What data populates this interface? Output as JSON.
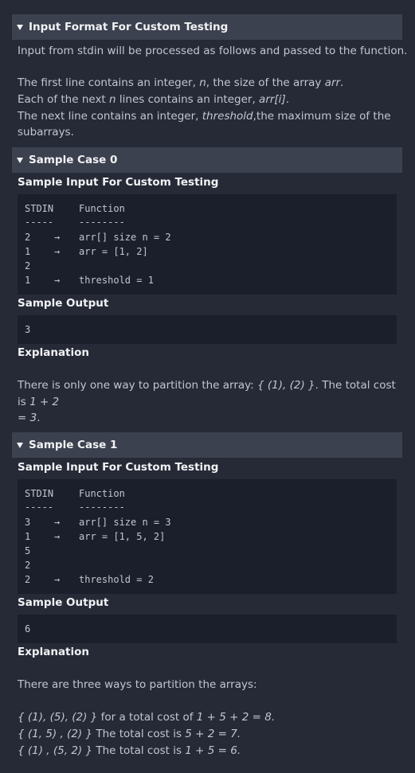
{
  "input_format": {
    "header": "Input Format For Custom Testing",
    "intro": "Input from stdin will be processed as follows and passed to the function.",
    "line1_a": "The first line contains an integer, ",
    "line1_n": "n",
    "line1_b": ", the size of the array ",
    "line1_arr": "arr",
    "line1_c": ".",
    "line2_a": "Each of the next ",
    "line2_n": "n",
    "line2_b": " lines contains an integer, ",
    "line2_arr": "arr[i]",
    "line2_c": ".",
    "line3_a": "The next line contains an integer, ",
    "line3_t": "threshold",
    "line3_b": ",the maximum size of the",
    "line3_c": "subarrays."
  },
  "case0": {
    "header": "Sample Case 0",
    "input_label": "Sample Input For Custom Testing",
    "col_stdin": "STDIN",
    "col_function": "Function",
    "sep_stdin": "-----",
    "sep_function": "--------",
    "rows": [
      {
        "stdin": "2",
        "arrow": "→",
        "fn": "arr[] size n = 2"
      },
      {
        "stdin": "1",
        "arrow": "→",
        "fn": "arr = [1, 2]"
      },
      {
        "stdin": "2",
        "arrow": "",
        "fn": ""
      },
      {
        "stdin": "1",
        "arrow": "→",
        "fn": "threshold = 1"
      }
    ],
    "output_label": "Sample Output",
    "output": "3",
    "explanation_label": "Explanation",
    "expl_a": "There is only one way to partition the array: ",
    "expl_part": "{ (1), (2) }",
    "expl_b": ". The total cost is ",
    "expl_sum": "1 + 2",
    "expl_eq": "= 3",
    "expl_end": "."
  },
  "case1": {
    "header": "Sample Case 1",
    "input_label": "Sample Input For Custom Testing",
    "col_stdin": "STDIN",
    "col_function": "Function",
    "sep_stdin": "-----",
    "sep_function": "--------",
    "rows": [
      {
        "stdin": "3",
        "arrow": "→",
        "fn": "arr[] size n = 3"
      },
      {
        "stdin": "1",
        "arrow": "→",
        "fn": "arr = [1, 5, 2]"
      },
      {
        "stdin": "5",
        "arrow": "",
        "fn": ""
      },
      {
        "stdin": "2",
        "arrow": "",
        "fn": ""
      },
      {
        "stdin": "2",
        "arrow": "→",
        "fn": "threshold = 2"
      }
    ],
    "output_label": "Sample Output",
    "output": "6",
    "explanation_label": "Explanation",
    "expl_intro": "There are three ways to partition the arrays:",
    "ways": [
      {
        "part": "{ (1), (5), (2) }",
        "text": " for a total cost of ",
        "calc": "1 + 5 + 2 = 8."
      },
      {
        "part": "{ (1, 5) , (2) }",
        "text": " The total cost is ",
        "calc": "5 + 2 = 7."
      },
      {
        "part": "{ (1) , (5, 2) }",
        "text": " The total cost is ",
        "calc": "1 + 5 = 6."
      }
    ]
  }
}
